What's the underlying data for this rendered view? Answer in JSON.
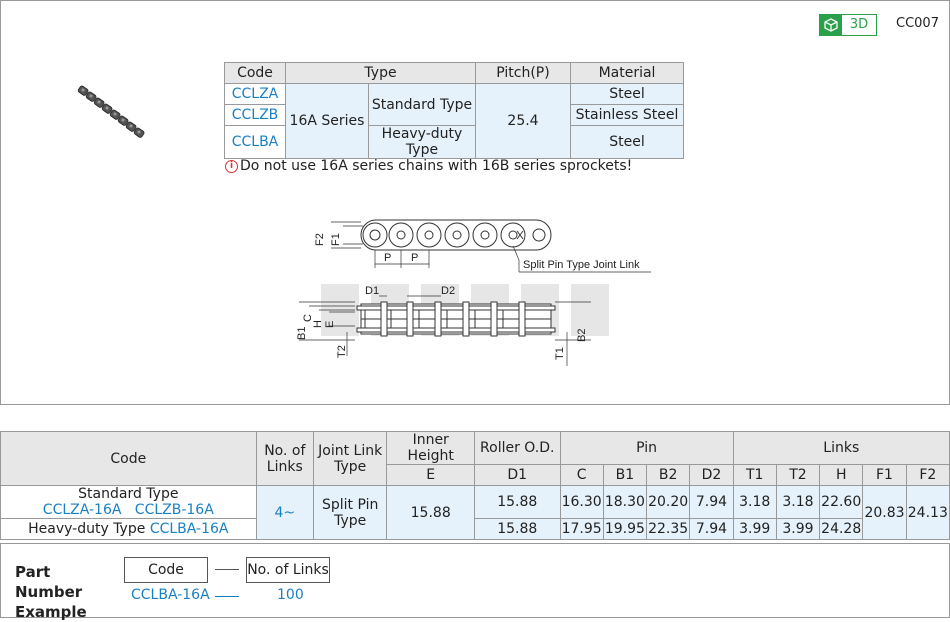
{
  "header": {
    "badge_label": "3D",
    "catalog_no": "CC007",
    "badge_color": "#2aa04a",
    "link_color": "#1a80c4"
  },
  "top_table": {
    "headers": [
      "Code",
      "Type",
      "Pitch(P)",
      "Material"
    ],
    "codes": [
      "CCLZA",
      "CCLZB",
      "CCLBA"
    ],
    "series": "16A Series",
    "types": [
      "Standard Type",
      "Heavy-duty Type"
    ],
    "pitch": "25.4",
    "materials": [
      "Steel",
      "Stainless Steel",
      "Steel"
    ]
  },
  "warning": "Do not use 16A series chains with 16B series sprockets!",
  "drawing": {
    "labels": [
      "F2",
      "F1",
      "P",
      "P",
      "Split Pin Type Joint Link",
      "D1",
      "D2",
      "B1",
      "C",
      "H",
      "E",
      "T2",
      "T1",
      "B2"
    ]
  },
  "spec_table": {
    "headers": {
      "code": "Code",
      "links": "No. of Links",
      "joint": "Joint Link Type",
      "inner_height": "Inner Height",
      "roller": "Roller O.D.",
      "pin": "Pin",
      "links_group": "Links",
      "e": "E",
      "d1": "D1",
      "c": "C",
      "b1": "B1",
      "b2": "B2",
      "d2": "D2",
      "t1": "T1",
      "t2": "T2",
      "h": "H",
      "f1": "F1",
      "f2": "F2"
    },
    "rows": [
      {
        "type_label": "Standard Type",
        "codes": "CCLZA-16A   CCLZB-16A",
        "d1": "15.88",
        "c": "16.30",
        "b1": "18.30",
        "b2": "20.20",
        "d2": "7.94",
        "t1": "3.18",
        "t2": "3.18",
        "h": "22.60"
      },
      {
        "type_label": "Heavy-duty Type",
        "codes": "CCLBA-16A",
        "d1": "15.88",
        "c": "17.95",
        "b1": "19.95",
        "b2": "22.35",
        "d2": "7.94",
        "t1": "3.99",
        "t2": "3.99",
        "h": "24.28"
      }
    ],
    "links_value": "4~",
    "joint_value": "Split Pin Type",
    "e_value": "15.88",
    "f1": "20.83",
    "f2": "24.13"
  },
  "part_number": {
    "title": "Part Number Example",
    "code_label": "Code",
    "links_label": "No. of Links",
    "code_value": "CCLBA-16A",
    "links_value": "100"
  }
}
